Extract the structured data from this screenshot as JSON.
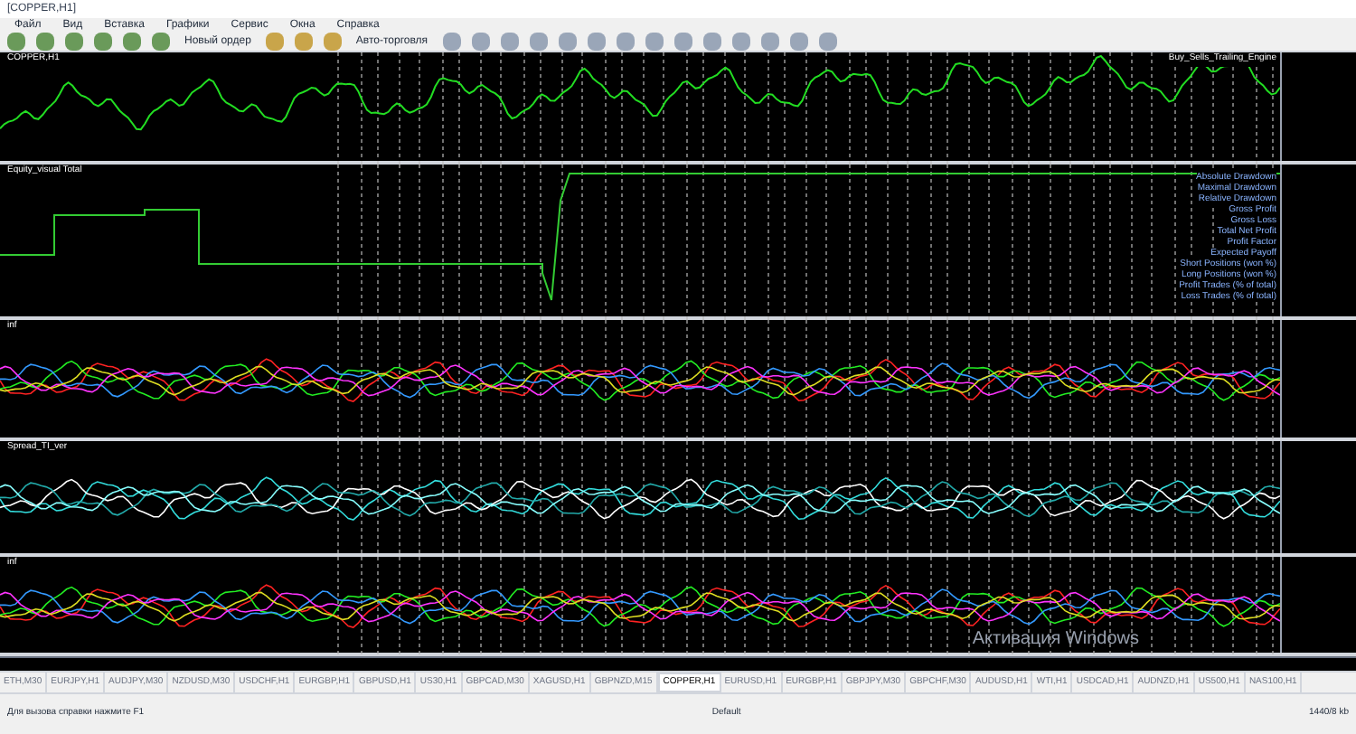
{
  "window": {
    "title": "[COPPER,H1]"
  },
  "menu": [
    "Файл",
    "Вид",
    "Вставка",
    "Графики",
    "Сервис",
    "Окна",
    "Справка"
  ],
  "toolbar": {
    "new_order": "Новый ордер",
    "auto_trading": "Авто-торговля"
  },
  "charts": [
    {
      "kind": "price",
      "label": "COPPER,H1",
      "right_label": "Buy_Sells_Trailing_Engine"
    },
    {
      "kind": "equity",
      "label": "Equity_visual Total",
      "stats": [
        "Absolute Drawdown",
        "Maximal Drawdown",
        "Relative Drawdown",
        "Gross Profit",
        "Gross Loss",
        "Total Net Profit",
        "Profit Factor",
        "Expected Payoff",
        "Short Positions (won %)",
        "Long Positions (won %)",
        "Profit Trades (% of total)",
        "Loss Trades (% of total)"
      ]
    },
    {
      "kind": "lines",
      "label": "inf"
    },
    {
      "kind": "spread",
      "label": "Spread_TI_ver"
    },
    {
      "kind": "lines",
      "label": "inf"
    }
  ],
  "overlay": "Активация Windows",
  "tabs": [
    {
      "label": "ETH,M30",
      "selected": false
    },
    {
      "label": "EURJPY,H1",
      "selected": false
    },
    {
      "label": "AUDJPY,M30",
      "selected": false
    },
    {
      "label": "NZDUSD,M30",
      "selected": false
    },
    {
      "label": "USDCHF,H1",
      "selected": false
    },
    {
      "label": "EURGBP,H1",
      "selected": false
    },
    {
      "label": "GBPUSD,H1",
      "selected": false
    },
    {
      "label": "US30,H1",
      "selected": false
    },
    {
      "label": "GBPCAD,M30",
      "selected": false
    },
    {
      "label": "XAGUSD,H1",
      "selected": false
    },
    {
      "label": "GBPNZD,M15",
      "selected": false
    },
    {
      "label": "COPPER,H1",
      "selected": true
    },
    {
      "label": "EURUSD,H1",
      "selected": false
    },
    {
      "label": "EURGBP,H1",
      "selected": false
    },
    {
      "label": "GBPJPY,M30",
      "selected": false
    },
    {
      "label": "GBPCHF,M30",
      "selected": false
    },
    {
      "label": "AUDUSD,H1",
      "selected": false
    },
    {
      "label": "WTI,H1",
      "selected": false
    },
    {
      "label": "USDCAD,H1",
      "selected": false
    },
    {
      "label": "AUDNZD,H1",
      "selected": false
    },
    {
      "label": "US500,H1",
      "selected": false
    },
    {
      "label": "NAS100,H1",
      "selected": false
    }
  ],
  "status_bar": {
    "help": "Для вызова справки нажмите F1",
    "profile": "Default",
    "traffic": "1440/8 kb"
  }
}
